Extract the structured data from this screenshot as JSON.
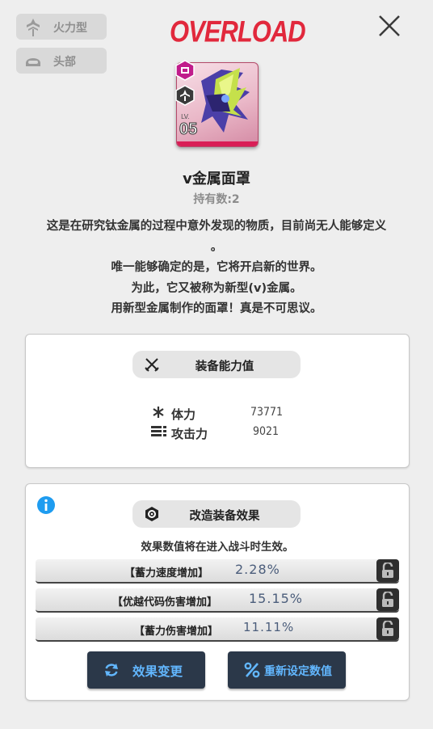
{
  "tags": {
    "type_label": "火力型",
    "slot_label": "头部"
  },
  "brand": {
    "logo_text": "OVERLOAD"
  },
  "item": {
    "level": "05",
    "level_prefix": "LV.",
    "name": "v金属面罩",
    "owned": "持有数:2",
    "description": [
      "这是在研究钛金属的过程中意外发现的物质，目前尚无人能够定义",
      "。",
      "唯一能够确定的是，它将开启新的世界。",
      "为此，它又被称为新型(v)金属。",
      "用新型金属制作的面罩！真是不可思议。"
    ]
  },
  "stats_panel": {
    "title": "装备能力值",
    "stats": [
      {
        "label": "体力",
        "value": "73771"
      },
      {
        "label": "攻击力",
        "value": "9021"
      }
    ]
  },
  "effects_panel": {
    "title": "改造装备效果",
    "subtitle": "效果数值将在进入战斗时生效。",
    "effects": [
      {
        "name": "【蓄力速度增加】",
        "value": "2.28%"
      },
      {
        "name": "【优越代码伤害增加】",
        "value": "15.15%"
      },
      {
        "name": "【蓄力伤害增加】",
        "value": "11.11%"
      }
    ],
    "buttons": {
      "change": "效果变更",
      "reset": "重新设定数值"
    }
  },
  "colors": {
    "accent_red": "#e1283c",
    "button_bg": "#2b3849",
    "button_text": "#62b7ff",
    "info_blue": "#1e9cf0"
  }
}
